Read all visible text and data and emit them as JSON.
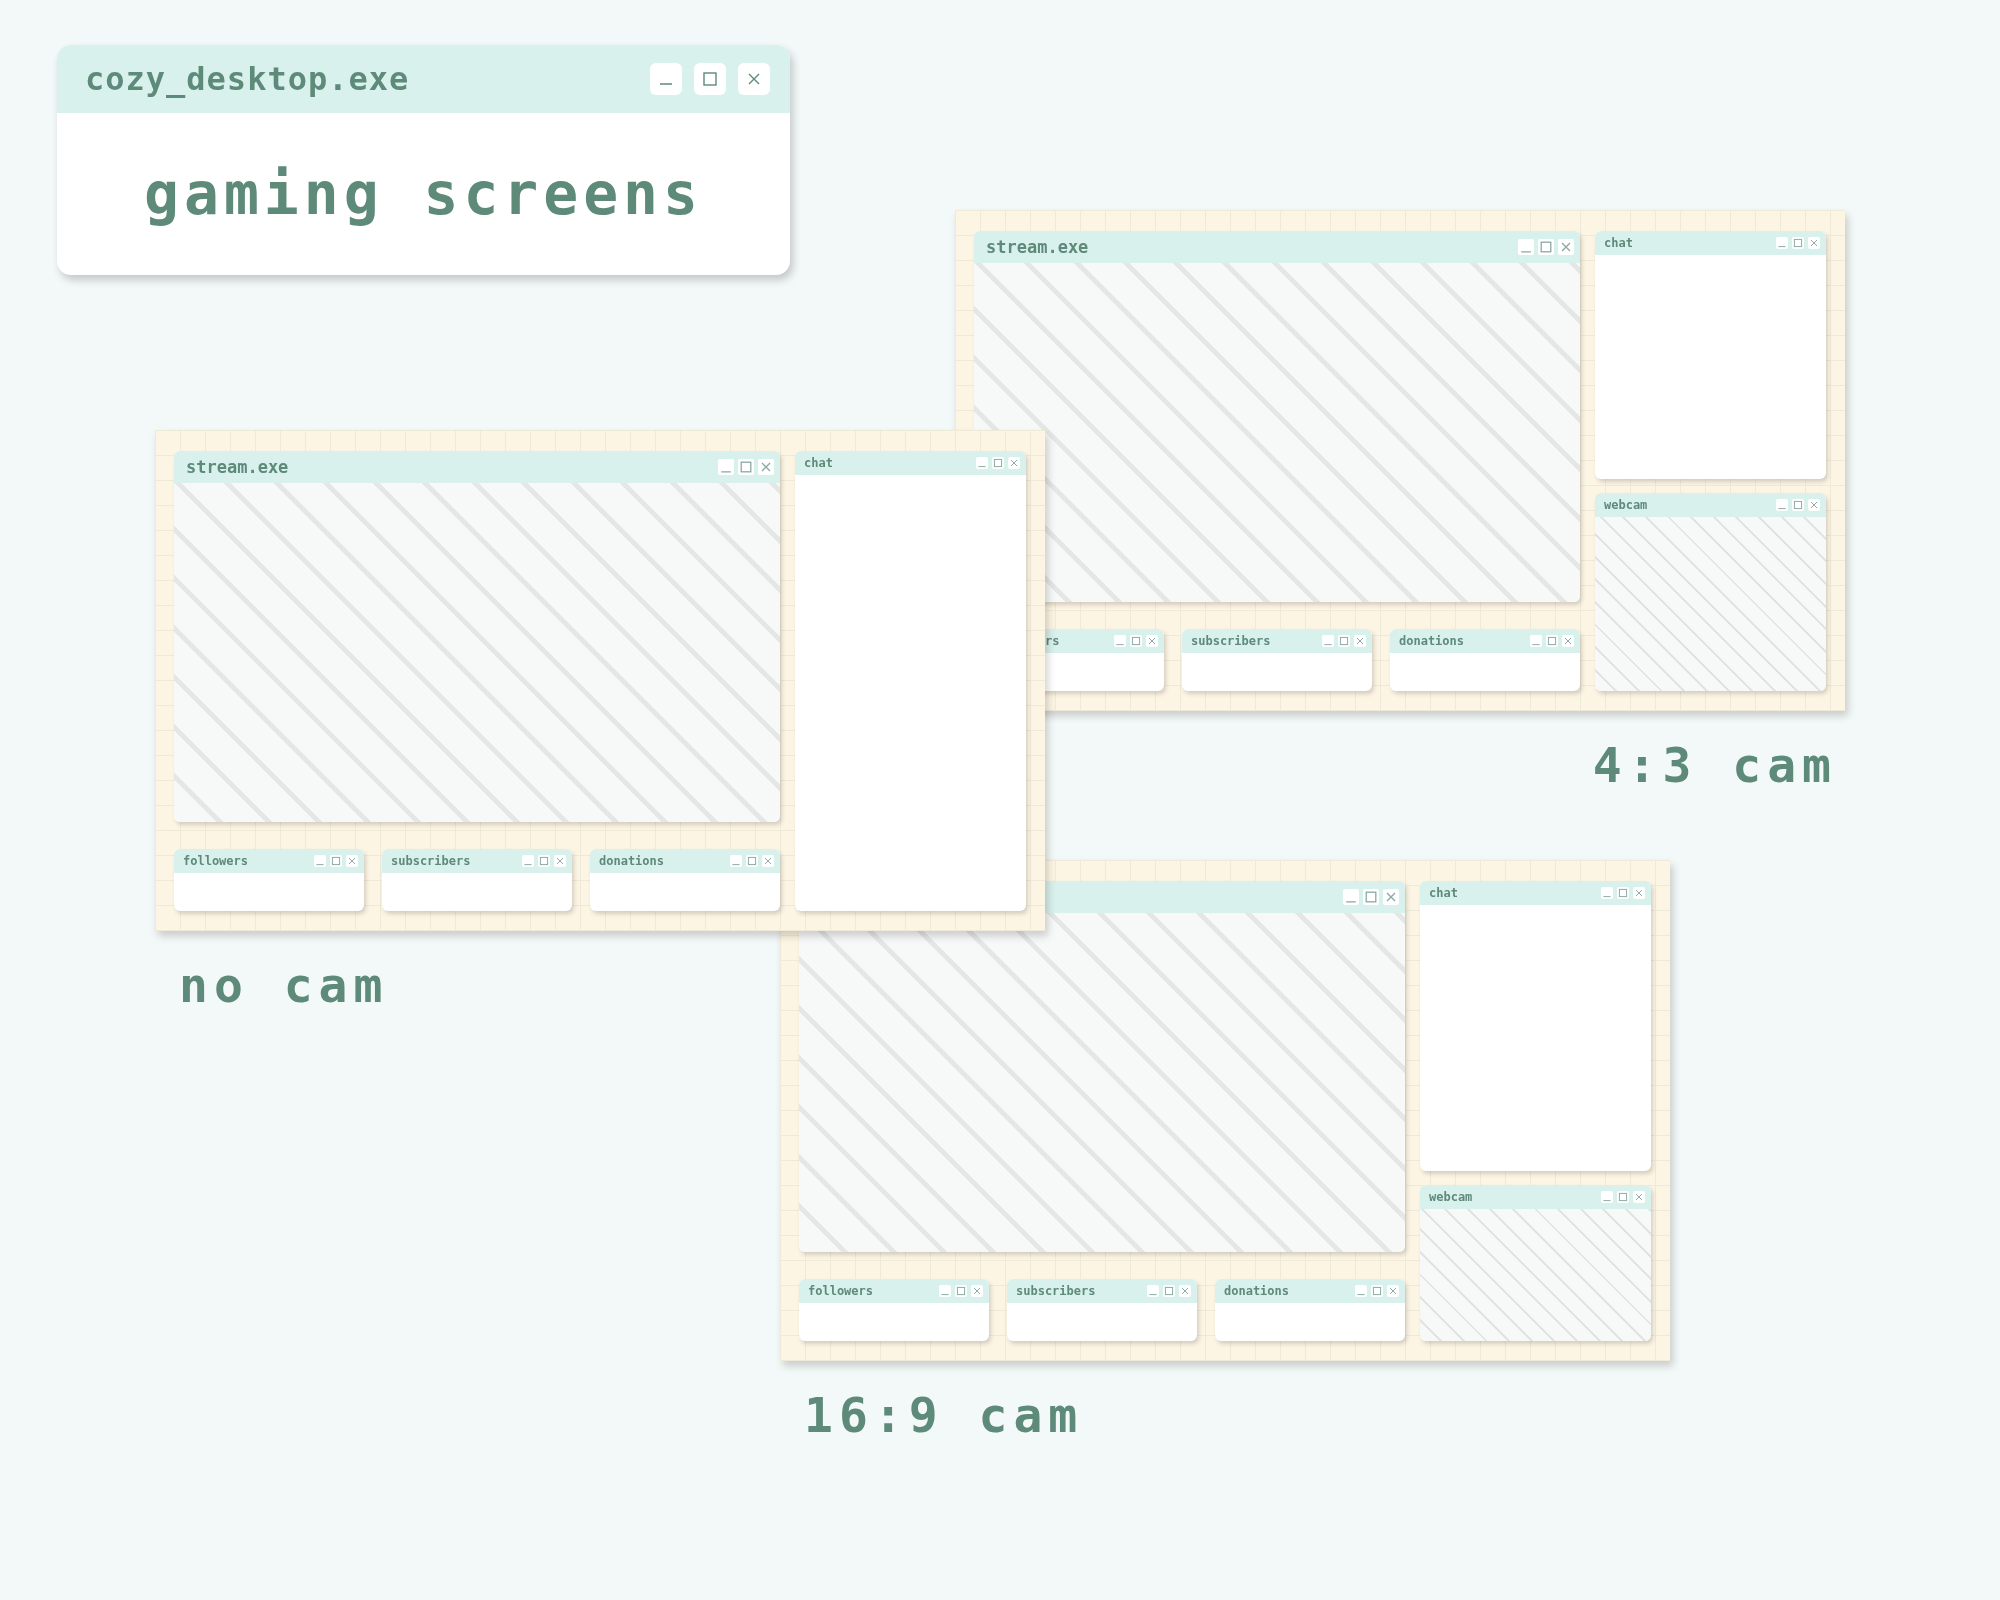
{
  "header_window": {
    "title": "cozy_desktop.exe",
    "heading": "gaming screens"
  },
  "scenes": [
    {
      "kind": "cam_4_3",
      "label": "4:3 cam",
      "windows": [
        {
          "kind": "stream",
          "title": "stream.exe"
        },
        {
          "kind": "chat",
          "title": "chat"
        },
        {
          "kind": "webcam",
          "title": "webcam"
        },
        {
          "kind": "widget",
          "title": "rs",
          "cut": true
        },
        {
          "kind": "widget",
          "title": "subscribers"
        },
        {
          "kind": "widget",
          "title": "donations"
        }
      ]
    },
    {
      "kind": "no_cam",
      "label": "no cam",
      "windows": [
        {
          "kind": "stream",
          "title": "stream.exe"
        },
        {
          "kind": "chat",
          "title": "chat"
        },
        {
          "kind": "widget",
          "title": "followers"
        },
        {
          "kind": "widget",
          "title": "subscribers"
        },
        {
          "kind": "widget",
          "title": "donations"
        }
      ]
    },
    {
      "kind": "cam_16_9",
      "label": "16:9 cam",
      "windows": [
        {
          "kind": "stream"
        },
        {
          "kind": "chat",
          "title": "chat"
        },
        {
          "kind": "webcam",
          "title": "webcam"
        },
        {
          "kind": "widget",
          "title": "followers"
        },
        {
          "kind": "widget",
          "title": "subscribers"
        },
        {
          "kind": "widget",
          "title": "donations"
        }
      ]
    }
  ]
}
